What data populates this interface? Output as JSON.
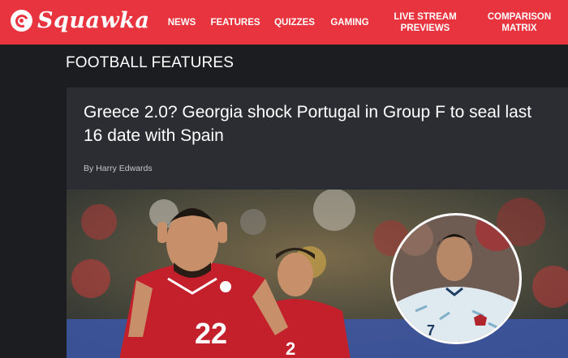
{
  "header": {
    "brand": "Squawka",
    "nav": [
      {
        "label": "NEWS"
      },
      {
        "label": "FEATURES"
      },
      {
        "label": "QUIZZES"
      },
      {
        "label": "GAMING"
      },
      {
        "label": "LIVE STREAM PREVIEWS"
      },
      {
        "label": "COMPARISON MATRIX"
      }
    ]
  },
  "section": {
    "title": "FOOTBALL FEATURES"
  },
  "article": {
    "headline": "Greece 2.0? Georgia shock Portugal in Group F to seal last 16 date with Spain",
    "byline": "By Harry Edwards",
    "image": {
      "player_number": "22",
      "inset_number": "7"
    }
  },
  "colors": {
    "brand_red": "#e8343f",
    "page_bg": "#1c1d21",
    "card_bg": "#2b2d32",
    "georgia_red": "#c4202b",
    "portugal_away": "#dfe9f0"
  }
}
